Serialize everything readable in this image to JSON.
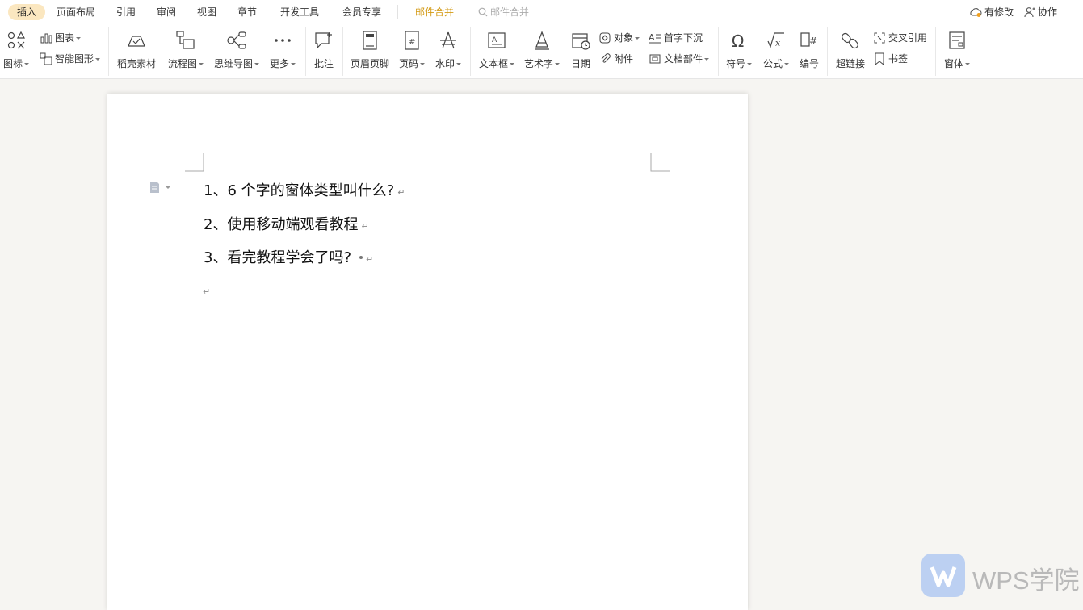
{
  "tabs": [
    {
      "label": "插入",
      "active": true
    },
    {
      "label": "页面布局"
    },
    {
      "label": "引用"
    },
    {
      "label": "审阅"
    },
    {
      "label": "视图"
    },
    {
      "label": "章节"
    },
    {
      "label": "开发工具"
    },
    {
      "label": "会员专享"
    },
    {
      "label": "邮件合并",
      "accent": "#d39a14"
    }
  ],
  "search": {
    "placeholder": "邮件合并",
    "icon": "search-icon"
  },
  "status": {
    "modified": "有修改",
    "collab": "协作"
  },
  "ribbon": {
    "icons_btn": "图标",
    "chart": "图表",
    "smartart": "智能图形",
    "material": "稻壳素材",
    "flowchart": "流程图",
    "mindmap": "思维导图",
    "more": "更多",
    "comment": "批注",
    "header_footer": "页眉页脚",
    "page_number": "页码",
    "watermark": "水印",
    "textbox": "文本框",
    "wordart": "艺术字",
    "date": "日期",
    "object": "对象",
    "attachment": "附件",
    "dropcap": "首字下沉",
    "doc_parts": "文档部件",
    "symbol": "符号",
    "formula": "公式",
    "numbering": "编号",
    "hyperlink": "超链接",
    "crossref": "交叉引用",
    "bookmark": "书签",
    "window_body": "窗体"
  },
  "document": {
    "paragraphs": [
      "1、6 个字的窗体类型叫什么?",
      "2、使用移动端观看教程",
      "3、看完教程学会了吗?"
    ],
    "para_mark": "↵"
  },
  "watermark_text": "WPS学院",
  "colors": {
    "accent": "#d39a14",
    "active_tab_bg": "#fbe7c0",
    "canvas": "#f6f5f2"
  }
}
